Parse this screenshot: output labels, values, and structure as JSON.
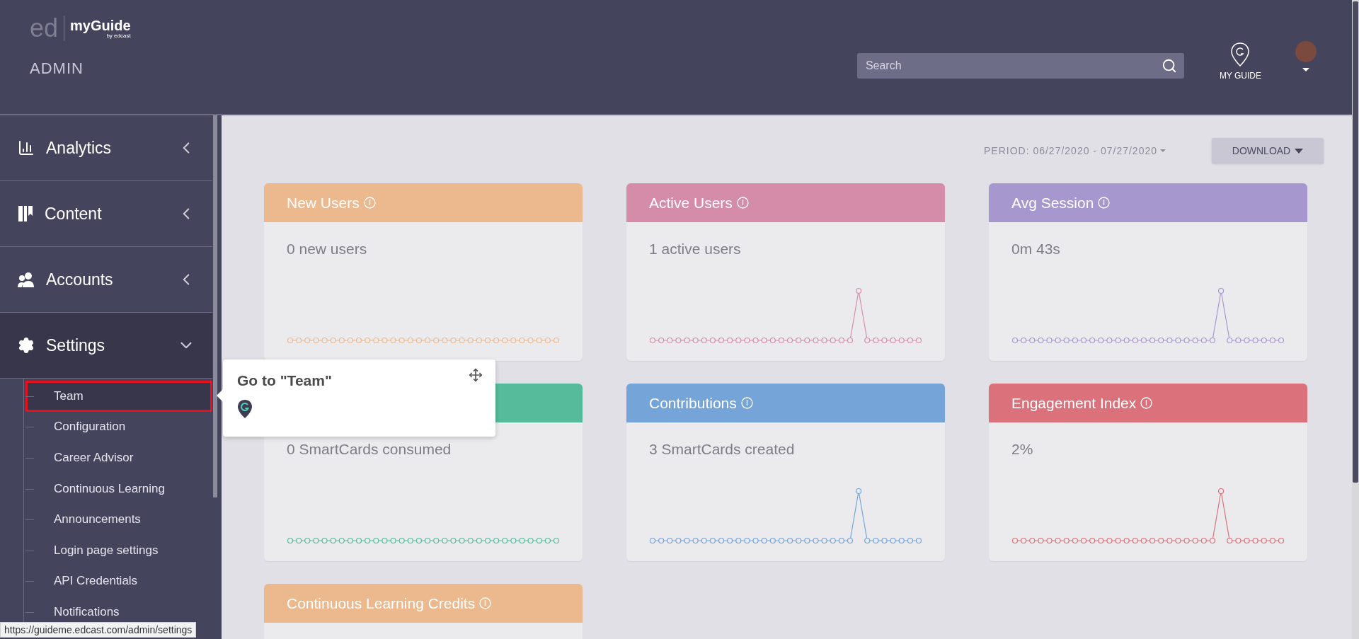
{
  "header": {
    "logo": {
      "mark": "ed",
      "name": "myGuide",
      "byline": "by edcast"
    },
    "subtitle": "ADMIN",
    "search": {
      "placeholder": "Search"
    },
    "my_guide": "MY GUIDE"
  },
  "sidebar": {
    "items": [
      {
        "label": "Analytics",
        "expanded": false
      },
      {
        "label": "Content",
        "expanded": false
      },
      {
        "label": "Accounts",
        "expanded": false
      },
      {
        "label": "Settings",
        "expanded": true,
        "children": [
          {
            "label": "Team",
            "selected": true
          },
          {
            "label": "Configuration",
            "selected": false
          },
          {
            "label": "Career Advisor",
            "selected": false
          },
          {
            "label": "Continuous Learning",
            "selected": false
          },
          {
            "label": "Announcements",
            "selected": false
          },
          {
            "label": "Login page settings",
            "selected": false
          },
          {
            "label": "API Credentials",
            "selected": false
          },
          {
            "label": "Notifications",
            "selected": false
          }
        ]
      }
    ]
  },
  "toolbar": {
    "period": "PERIOD: 06/27/2020 - 07/27/2020",
    "download": "DOWNLOAD"
  },
  "cards": [
    {
      "kind": "flat",
      "title": "New Users",
      "value": "0 new users",
      "color": "#ecb98f"
    },
    {
      "kind": "spike",
      "title": "Active Users",
      "value": "1 active users",
      "color": "#d58ca9"
    },
    {
      "kind": "spike",
      "title": "Avg Session",
      "value": "0m 43s",
      "color": "#a797cf"
    },
    {
      "kind": "flat",
      "value": "0 SmartCards consumed",
      "color": "#56bb9b"
    },
    {
      "kind": "spike",
      "title": "Contributions",
      "value": "3 SmartCards created",
      "color": "#74a4d8"
    },
    {
      "kind": "spike",
      "title": "Engagement Index",
      "value": "2%",
      "color": "#da717b"
    },
    {
      "kind": "cut",
      "title": "Continuous Learning Credits",
      "color": "#ecb98f"
    }
  ],
  "guide_tooltip": {
    "title": "Go to \"Team\""
  },
  "status_url": "https://guideme.edcast.com/admin/settings"
}
